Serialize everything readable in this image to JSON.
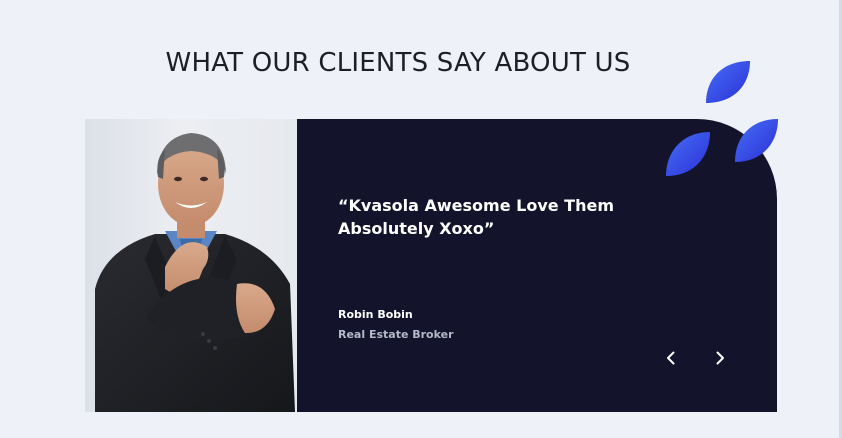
{
  "section": {
    "title": "WHAT OUR CLIENTS SAY ABOUT US"
  },
  "testimonial": {
    "quote": "“Kvasola Awesome Love Them Absolutely Xoxo”",
    "author_name": "Robin Bobin",
    "author_role": "Real Estate Broker"
  },
  "icons": {
    "prev": "chevron-left-icon",
    "next": "chevron-right-icon",
    "decor": "leaf-icon"
  },
  "colors": {
    "background": "#eef1f8",
    "panel": "#13142b",
    "accent_start": "#3f6cf5",
    "accent_end": "#2f2fd8",
    "title": "#1d1f24"
  }
}
